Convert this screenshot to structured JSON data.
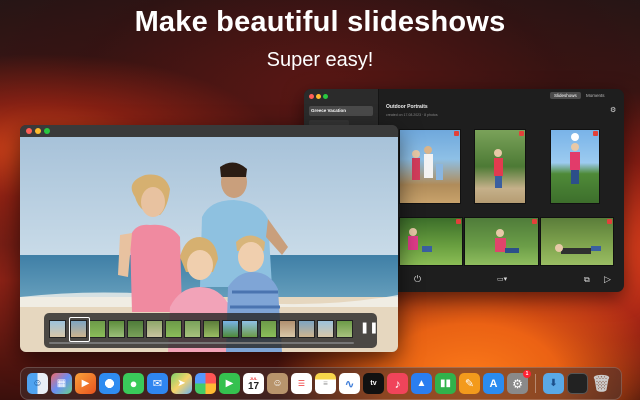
{
  "hero": {
    "title": "Make beautiful slideshows",
    "subtitle": "Super easy!"
  },
  "library": {
    "sidebar_selected": "Greece Vacation",
    "tabs": [
      "Slideshows",
      "Moments"
    ],
    "album_title": "Outdoor Portraits",
    "album_meta": "created on 17.08.2023 · 8 photos"
  },
  "dock": {
    "apps": [
      "finder-icon",
      "launchpad-icon",
      "slideshow-app-icon",
      "safari-icon",
      "messages-icon",
      "mail-icon",
      "maps-icon",
      "photos-icon",
      "facetime-icon",
      "calendar-icon",
      "contacts-icon",
      "reminders-icon",
      "notes-icon",
      "freeform-icon",
      "apple-tv-icon",
      "music-icon",
      "keynote-icon",
      "numbers-icon",
      "pages-icon",
      "app-store-icon",
      "system-settings-icon",
      "downloads-folder-icon",
      "screen-icon",
      "trash-icon"
    ],
    "calendar": {
      "month": "JUL",
      "day": "17"
    },
    "tv_label": "tv",
    "settings_badge": "1"
  }
}
